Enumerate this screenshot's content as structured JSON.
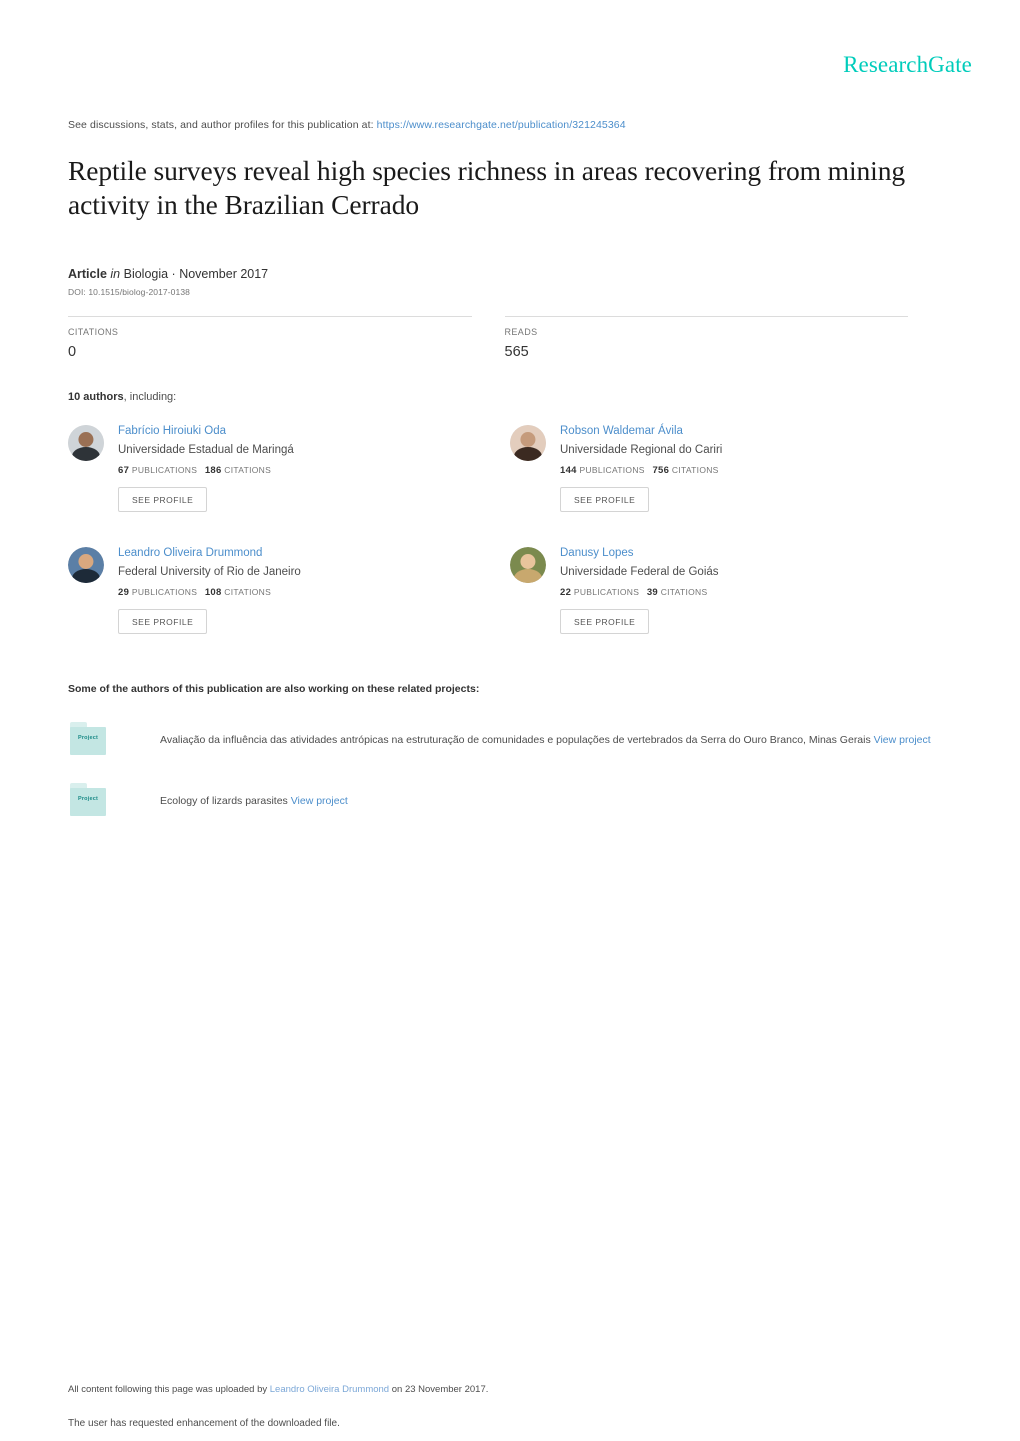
{
  "brand": {
    "logo_text": "ResearchGate",
    "logo_color": "#00ccbb",
    "link_color": "#4c8ecb"
  },
  "header": {
    "discuss_prefix": "See discussions, stats, and author profiles for this publication at:",
    "publication_url": "https://www.researchgate.net/publication/321245364"
  },
  "publication": {
    "title": "Reptile surveys reveal high species richness in areas recovering from mining activity in the Brazilian Cerrado",
    "type_label": "Article",
    "in_label": "in",
    "venue": "Biologia · November 2017",
    "doi": "DOI: 10.1515/biolog-2017-0138"
  },
  "stats": [
    {
      "label": "CITATIONS",
      "value": "0"
    },
    {
      "label": "READS",
      "value": "565"
    }
  ],
  "authors_section": {
    "count_label": "10 authors",
    "count_suffix": ", including:",
    "see_profile_label": "SEE PROFILE",
    "publications_label": "PUBLICATIONS",
    "citations_label": "CITATIONS"
  },
  "authors": [
    {
      "name": "Fabrício Hiroiuki Oda",
      "org": "Universidade Estadual de Maringá",
      "publications": "67",
      "citations": "186",
      "avatar": "author-photo-oda",
      "avatar_bg": "#cfd4d8",
      "avatar_skin": "#9a7054",
      "avatar_body": "#2e3338"
    },
    {
      "name": "Robson Waldemar Ávila",
      "org": "Universidade Regional do Cariri",
      "publications": "144",
      "citations": "756",
      "avatar": "author-photo-avila",
      "avatar_bg": "#e3cdbd",
      "avatar_skin": "#c59b7c",
      "avatar_body": "#3b2a21"
    },
    {
      "name": "Leandro Oliveira Drummond",
      "org": "Federal University of Rio de Janeiro",
      "publications": "29",
      "citations": "108",
      "avatar": "author-photo-drummond",
      "avatar_bg": "#5b7fa6",
      "avatar_skin": "#d9a87f",
      "avatar_body": "#1d2a38"
    },
    {
      "name": "Danusy Lopes",
      "org": "Universidade Federal de Goiás",
      "publications": "22",
      "citations": "39",
      "avatar": "author-photo-lopes",
      "avatar_bg": "#7b8a4e",
      "avatar_skin": "#e8c49c",
      "avatar_body": "#c8a86e"
    }
  ],
  "projects_section": {
    "heading": "Some of the authors of this publication are also working on these related projects:",
    "folder_icon_label": "Project",
    "view_project_label": "View project"
  },
  "projects": [
    {
      "title": "Avaliação da influência das atividades antrópicas na estruturação de comunidades e populações de vertebrados da Serra do Ouro Branco, Minas Gerais"
    },
    {
      "title": "Ecology of lizards parasites"
    }
  ],
  "footer": {
    "upload_prefix": "All content following this page was uploaded by",
    "uploader": "Leandro Oliveira Drummond",
    "upload_suffix": "on 23 November 2017.",
    "enhancement_note": "The user has requested enhancement of the downloaded file."
  }
}
